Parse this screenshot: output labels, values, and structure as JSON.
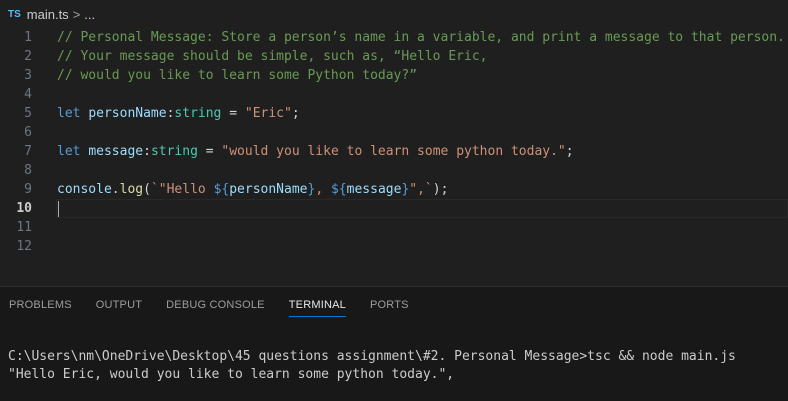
{
  "breadcrumb": {
    "lang_badge": "TS",
    "file_name": "main.ts",
    "separator": ">",
    "ellipsis": "..."
  },
  "editor": {
    "line_numbers": [
      "1",
      "2",
      "3",
      "4",
      "5",
      "6",
      "7",
      "8",
      "9",
      "10",
      "11",
      "12"
    ],
    "active_line": "10",
    "lines": {
      "l1": "// Personal Message: Store a person’s name in a variable, and print a message to that person.",
      "l2": "// Your message should be simple, such as, “Hello Eric,",
      "l3": "// would you like to learn some Python today?”",
      "l5": {
        "kw": "let",
        "var": "personName",
        "colon": ":",
        "type": "string",
        "eq": " = ",
        "str": "\"Eric\"",
        "semi": ";"
      },
      "l7": {
        "kw": "let",
        "var": "message",
        "colon": ":",
        "type": "string",
        "eq": " = ",
        "str": "\"would you like to learn some python today.\"",
        "semi": ";"
      },
      "l9": {
        "obj": "console",
        "dot": ".",
        "fn": "log",
        "open": "(",
        "s1": "`\"Hello ",
        "d1": "${",
        "v1": "personName",
        "c1": "}",
        "s2": ", ",
        "d2": "${",
        "v2": "message",
        "c2": "}",
        "s3": "\",`",
        "close": ");"
      }
    }
  },
  "panel": {
    "tabs": [
      "PROBLEMS",
      "OUTPUT",
      "DEBUG CONSOLE",
      "TERMINAL",
      "PORTS"
    ],
    "active_tab": "TERMINAL",
    "terminal_lines": [
      "C:\\Users\\nm\\OneDrive\\Desktop\\45 questions assignment\\#2. Personal Message>tsc && node main.js",
      "\"Hello Eric, would you like to learn some python today.\","
    ]
  }
}
